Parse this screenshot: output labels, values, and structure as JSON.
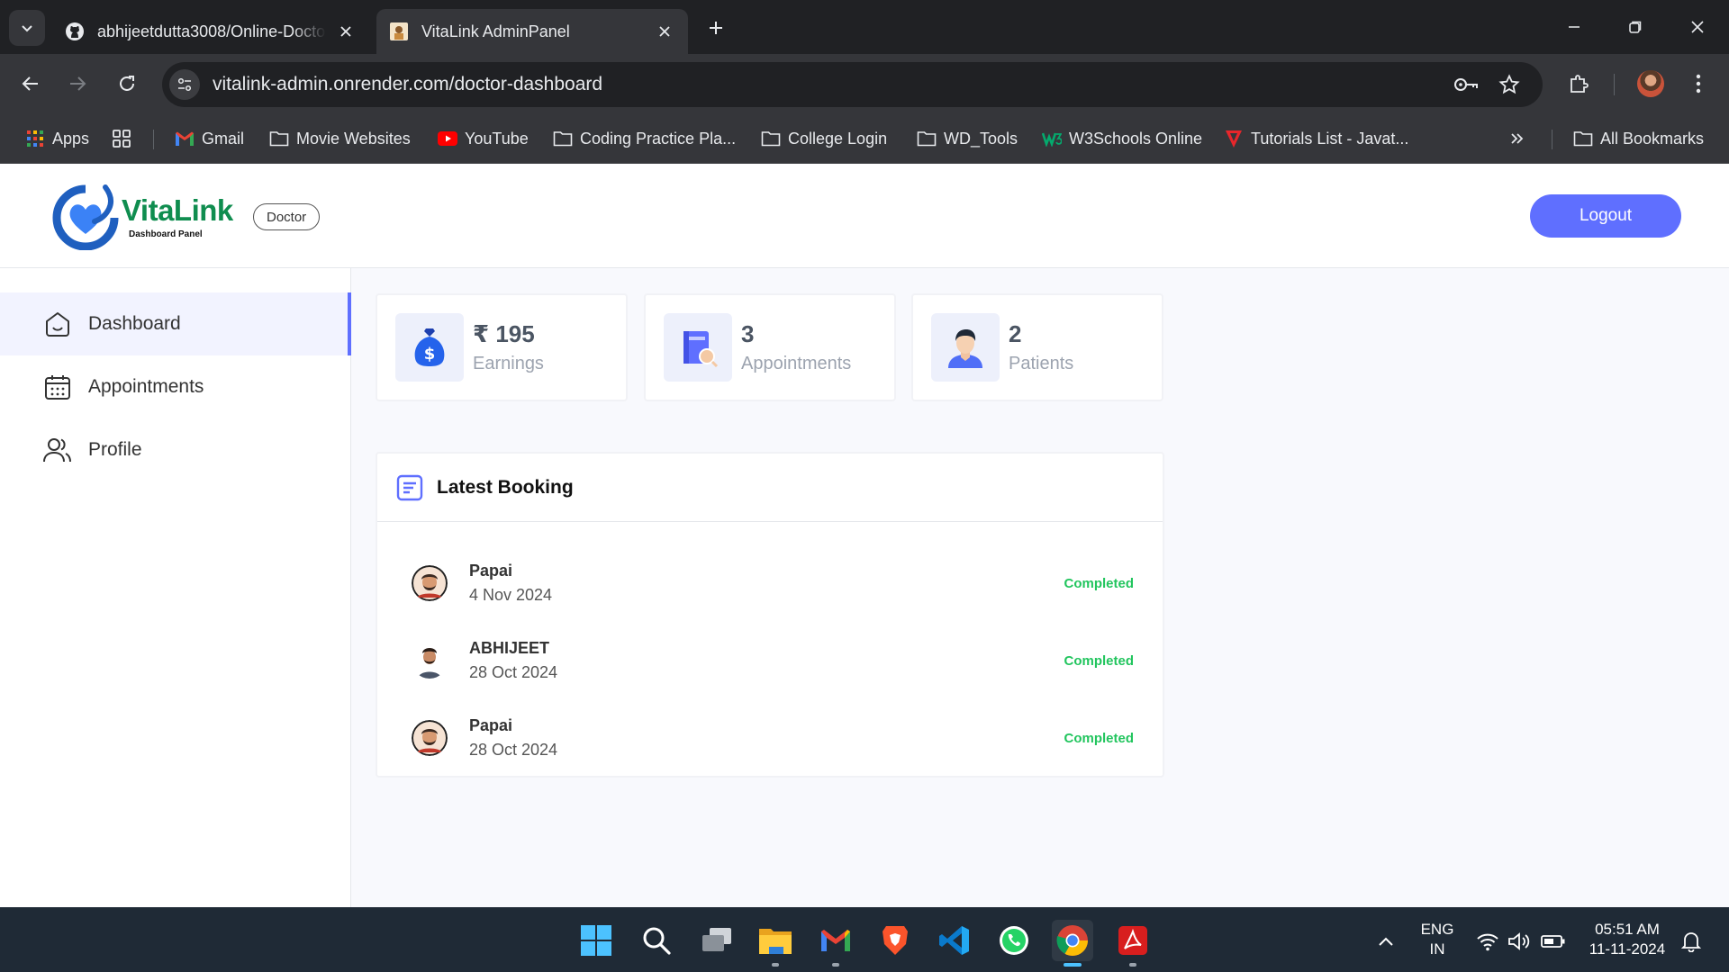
{
  "browser": {
    "tabs": [
      {
        "title": "abhijeetdutta3008/Online-Doctor-Appointment",
        "favicon": "github-icon",
        "active": false
      },
      {
        "title": "VitaLink AdminPanel",
        "favicon": "vitalink-favicon",
        "active": true
      }
    ],
    "url": "vitalink-admin.onrender.com/doctor-dashboard",
    "bookmarks": [
      {
        "label": "Apps",
        "icon": "apps-grid-icon"
      },
      {
        "label": "",
        "icon": "tab-groups-icon"
      },
      {
        "label": "Gmail",
        "icon": "gmail-icon"
      },
      {
        "label": "Movie Websites",
        "icon": "folder-icon"
      },
      {
        "label": "YouTube",
        "icon": "youtube-icon"
      },
      {
        "label": "Coding Practice Pla...",
        "icon": "folder-icon"
      },
      {
        "label": "College Login",
        "icon": "folder-icon"
      },
      {
        "label": "WD_Tools",
        "icon": "folder-icon"
      },
      {
        "label": "W3Schools Online",
        "icon": "w3schools-icon"
      },
      {
        "label": "Tutorials List - Javat...",
        "icon": "javatpoint-icon"
      },
      {
        "label": "All Bookmarks",
        "icon": "folder-icon"
      }
    ]
  },
  "app": {
    "logo_text": "VitaLink",
    "logo_subtitle": "Dashboard Panel",
    "role_badge": "Doctor",
    "logout_label": "Logout",
    "accent_color": "#5f6fff"
  },
  "sidebar": {
    "items": [
      {
        "label": "Dashboard",
        "icon": "home-icon",
        "active": true
      },
      {
        "label": "Appointments",
        "icon": "calendar-icon",
        "active": false
      },
      {
        "label": "Profile",
        "icon": "people-icon",
        "active": false
      }
    ]
  },
  "stats": [
    {
      "value": "₹ 195",
      "label": "Earnings",
      "icon": "money-bag-icon"
    },
    {
      "value": "3",
      "label": "Appointments",
      "icon": "appointment-book-icon"
    },
    {
      "value": "2",
      "label": "Patients",
      "icon": "patient-icon"
    }
  ],
  "latest_booking": {
    "title": "Latest Booking",
    "rows": [
      {
        "name": "Papai",
        "date": "4 Nov 2024",
        "status": "Completed"
      },
      {
        "name": "ABHIJEET",
        "date": "28 Oct 2024",
        "status": "Completed"
      },
      {
        "name": "Papai",
        "date": "28 Oct 2024",
        "status": "Completed"
      }
    ],
    "status_color": "#22c55e"
  },
  "taskbar": {
    "language_line1": "ENG",
    "language_line2": "IN",
    "time": "05:51 AM",
    "date": "11-11-2024"
  }
}
